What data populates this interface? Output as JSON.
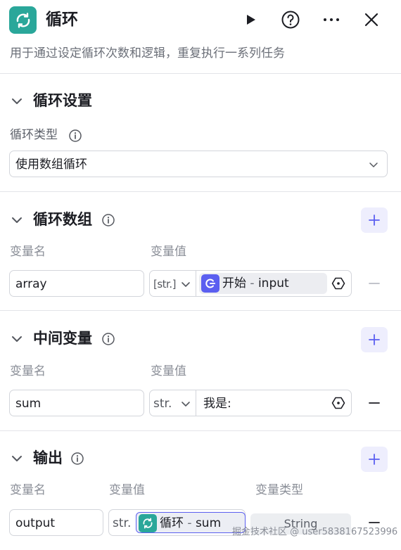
{
  "header": {
    "title": "循环",
    "description": "用于通过设定循环次数和逻辑，重复执行一系列任务"
  },
  "loop_settings": {
    "title": "循环设置",
    "loop_type_label": "循环类型",
    "loop_type_value": "使用数组循环"
  },
  "loop_array": {
    "title": "循环数组",
    "col_name": "变量名",
    "col_value": "变量值",
    "row": {
      "name": "array",
      "type": "[str.]",
      "ref_node": "开始",
      "ref_sep": " - ",
      "ref_var": "input"
    }
  },
  "intermediate": {
    "title": "中间变量",
    "col_name": "变量名",
    "col_value": "变量值",
    "row": {
      "name": "sum",
      "type": "str.",
      "value": "我是:"
    }
  },
  "output": {
    "title": "输出",
    "col_name": "变量名",
    "col_value": "变量值",
    "col_type": "变量类型",
    "row": {
      "name": "output",
      "type": "str.",
      "ref_node": "循环",
      "ref_sep": " - ",
      "ref_var": "sum",
      "var_type": "String"
    }
  },
  "watermark": "掘金技术社区 @ user5838167523996",
  "colors": {
    "brand_teal": "#2aa79a",
    "accent_purple": "#5b5ff0",
    "add_bg": "#eeeefd"
  }
}
